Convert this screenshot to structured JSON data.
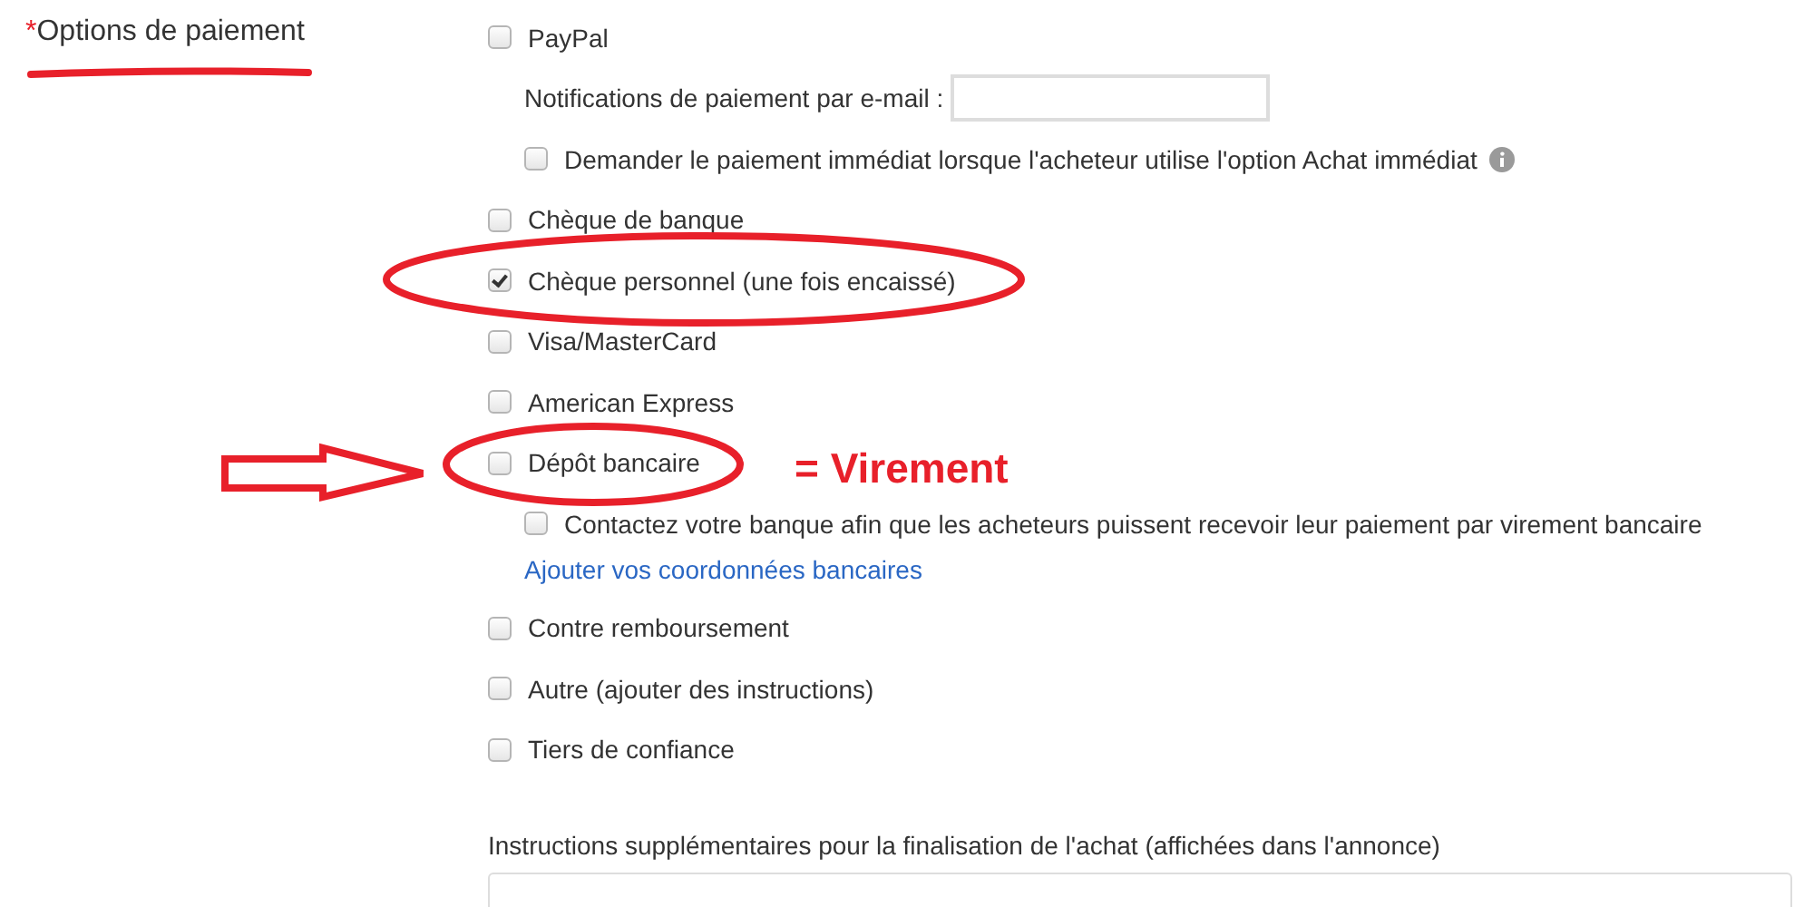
{
  "field_label": {
    "required_mark": "*",
    "text": "Options de paiement"
  },
  "options": [
    {
      "kind": "checkbox",
      "label": "PayPal",
      "checked": false,
      "children": [
        {
          "kind": "email",
          "label": "Notifications de paiement par e-mail :"
        },
        {
          "kind": "checkbox",
          "label": "Demander le paiement immédiat lorsque l'acheteur utilise l'option Achat immédiat",
          "checked": false,
          "info": true
        }
      ]
    },
    {
      "kind": "checkbox",
      "label": "Chèque de banque",
      "checked": false
    },
    {
      "kind": "checkbox",
      "label": "Chèque personnel (une fois encaissé)",
      "checked": true
    },
    {
      "kind": "checkbox",
      "label": "Visa/MasterCard",
      "checked": false
    },
    {
      "kind": "checkbox",
      "label": "American Express",
      "checked": false
    },
    {
      "kind": "checkbox",
      "label": "Dépôt bancaire",
      "checked": false,
      "children": [
        {
          "kind": "checkbox",
          "label": "Contactez votre banque afin que les acheteurs puissent recevoir leur paiement par virement bancaire",
          "checked": false
        },
        {
          "kind": "link",
          "label": "Ajouter vos coordonnées bancaires"
        }
      ]
    },
    {
      "kind": "checkbox",
      "label": "Contre remboursement",
      "checked": false
    },
    {
      "kind": "checkbox",
      "label": "Autre (ajouter des instructions)",
      "checked": false
    },
    {
      "kind": "checkbox",
      "label": "Tiers de confiance",
      "checked": false
    }
  ],
  "instructions": {
    "label": "Instructions supplémentaires pour la finalisation de l'achat (affichées dans l'annonce)"
  },
  "annotation": {
    "text": "= Virement"
  }
}
